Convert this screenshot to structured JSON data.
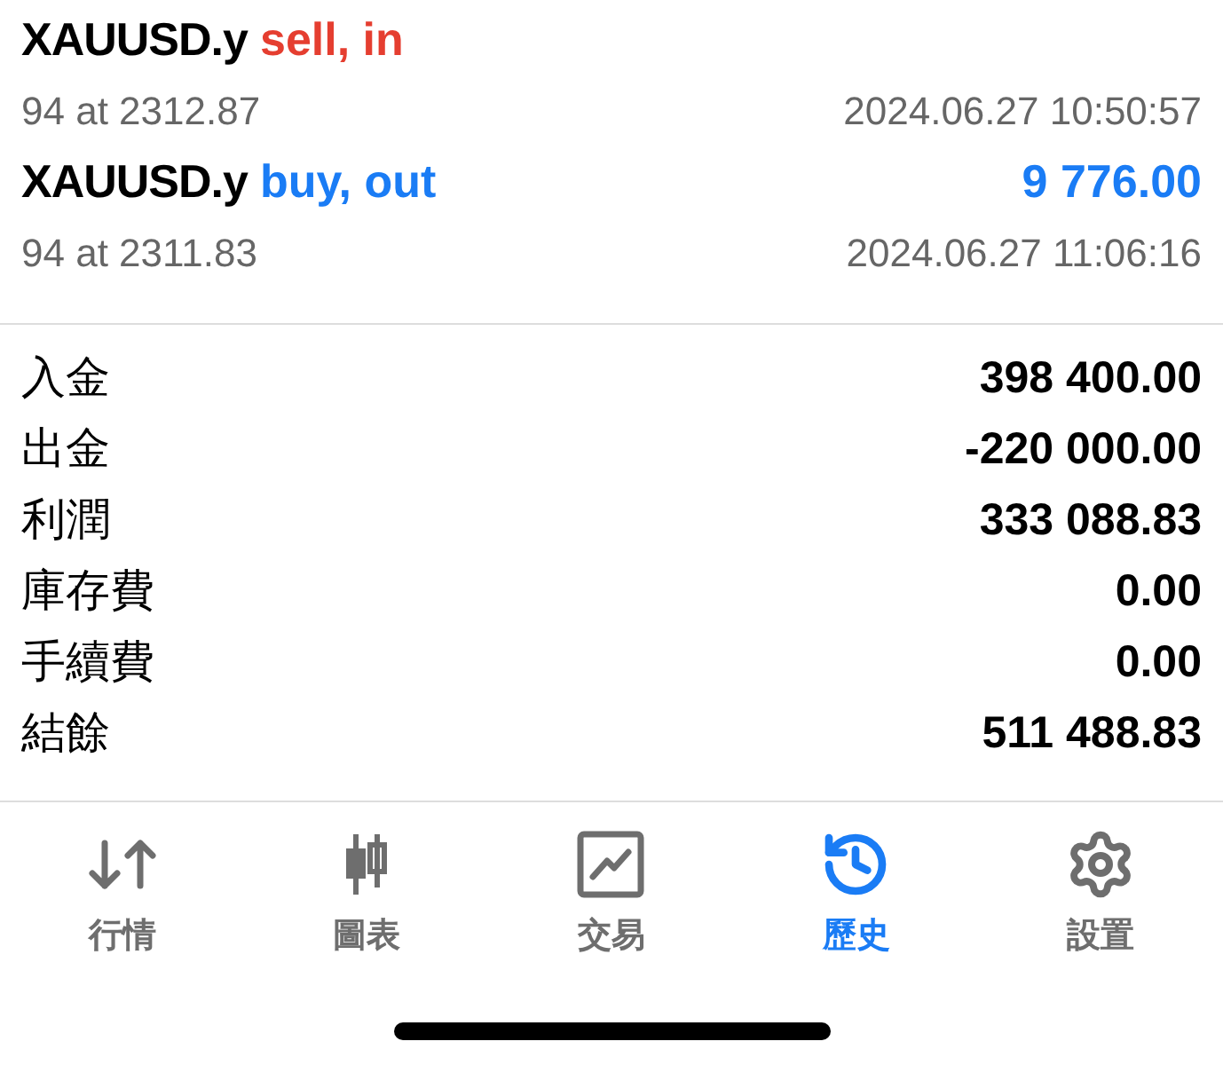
{
  "deals": [
    {
      "symbol": "XAUUSD.y",
      "action": "sell, in",
      "kind": "sell",
      "detail": "94 at 2312.87",
      "time": "2024.06.27 10:50:57"
    },
    {
      "symbol": "XAUUSD.y",
      "action": "buy, out",
      "kind": "buy",
      "profit": "9 776.00",
      "detail": "94 at 2311.83",
      "time": "2024.06.27 11:06:16"
    }
  ],
  "summary": [
    {
      "label": "入金",
      "value": "398 400.00"
    },
    {
      "label": "出金",
      "value": "-220 000.00"
    },
    {
      "label": "利潤",
      "value": "333 088.83"
    },
    {
      "label": "庫存費",
      "value": "0.00"
    },
    {
      "label": "手續費",
      "value": "0.00"
    },
    {
      "label": "結餘",
      "value": "511 488.83"
    }
  ],
  "tabs": [
    {
      "label": "行情",
      "kind": "quotes",
      "selected": false
    },
    {
      "label": "圖表",
      "kind": "chart",
      "selected": false
    },
    {
      "label": "交易",
      "kind": "trade",
      "selected": false
    },
    {
      "label": "歷史",
      "kind": "history",
      "selected": true
    },
    {
      "label": "設置",
      "kind": "settings",
      "selected": false
    }
  ]
}
